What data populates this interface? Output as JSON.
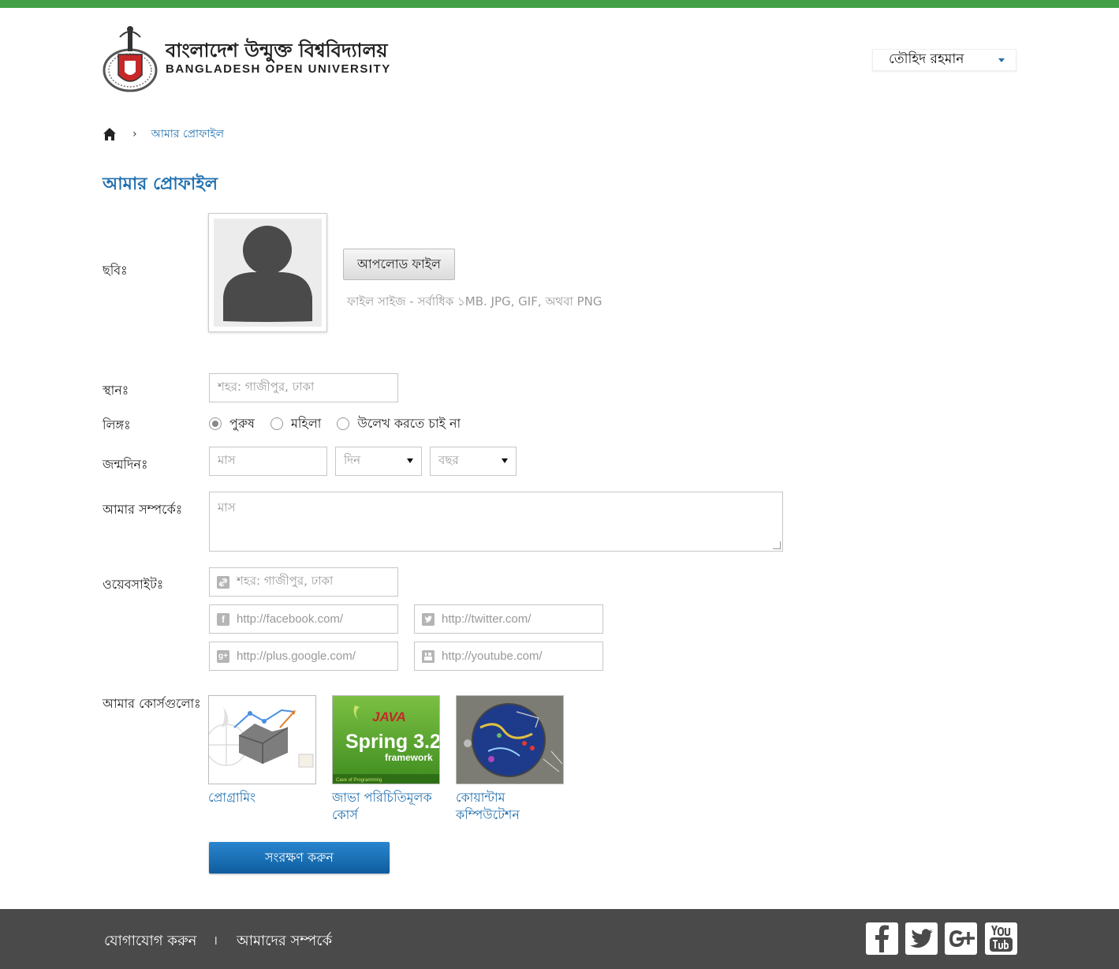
{
  "header": {
    "logo_bn": "বাংলাদেশ উন্মুক্ত বিশ্ববিদ্যালয়",
    "logo_en": "BANGLADESH OPEN UNIVERSITY",
    "user_name": "তৌহিদ রহমান"
  },
  "breadcrumb": {
    "sep": "›",
    "current": "আমার প্রোফাইল"
  },
  "page": {
    "title": "আমার প্রোফাইল"
  },
  "form": {
    "photo_label": "ছবিঃ",
    "upload_label": "আপলোড ফাইল",
    "upload_hint": "ফাইল সাইজ - সর্বাধিক ১MB. JPG, GIF, অথবা PNG",
    "location_label": "স্থানঃ",
    "location_placeholder": "শহর: গাজীপুর, ঢাকা",
    "gender_label": "লিঙ্গঃ",
    "gender_options": [
      "পুরুষ",
      "মহিলা",
      "উলেখ করতে চাই না"
    ],
    "gender_selected": 0,
    "dob_label": "জন্মদিনঃ",
    "dob_month": "মাস",
    "dob_day": "দিন",
    "dob_year": "বছর",
    "about_label": "আমার সম্পর্কেঃ",
    "about_placeholder": "মাস",
    "website_label": "ওয়েবসাইটঃ",
    "website_placeholder": "শহর: গাজীপুর, ঢাকা",
    "facebook_placeholder": "http://facebook.com/",
    "twitter_placeholder": "http://twitter.com/",
    "google_placeholder": "http://plus.google.com/",
    "youtube_placeholder": "http://youtube.com/",
    "courses_label": "আমার কোর্সগুলোঃ",
    "save_label": "সংরক্ষণ করুন"
  },
  "courses": [
    {
      "title": "প্রোগ্রামিং"
    },
    {
      "title": "জাভা পরিচিতিমূলক কোর্স",
      "thumb_line1": "JAVA",
      "thumb_line2": "Spring 3.2",
      "thumb_line3": "framework",
      "thumb_line4": "Cave of Programming"
    },
    {
      "title": "কোয়ান্টাম কম্পিউটেশন"
    }
  ],
  "footer": {
    "contact": "যোগাযোগ করুন",
    "sep": "।",
    "about": "আমাদের সম্পর্কে",
    "social": [
      "facebook-icon",
      "twitter-icon",
      "google-plus-icon",
      "youtube-icon"
    ]
  },
  "colors": {
    "brand_green": "#43a047",
    "link_blue": "#1f6fb0",
    "button_blue": "#1670b8",
    "footer_bg": "#4a4a4a"
  }
}
